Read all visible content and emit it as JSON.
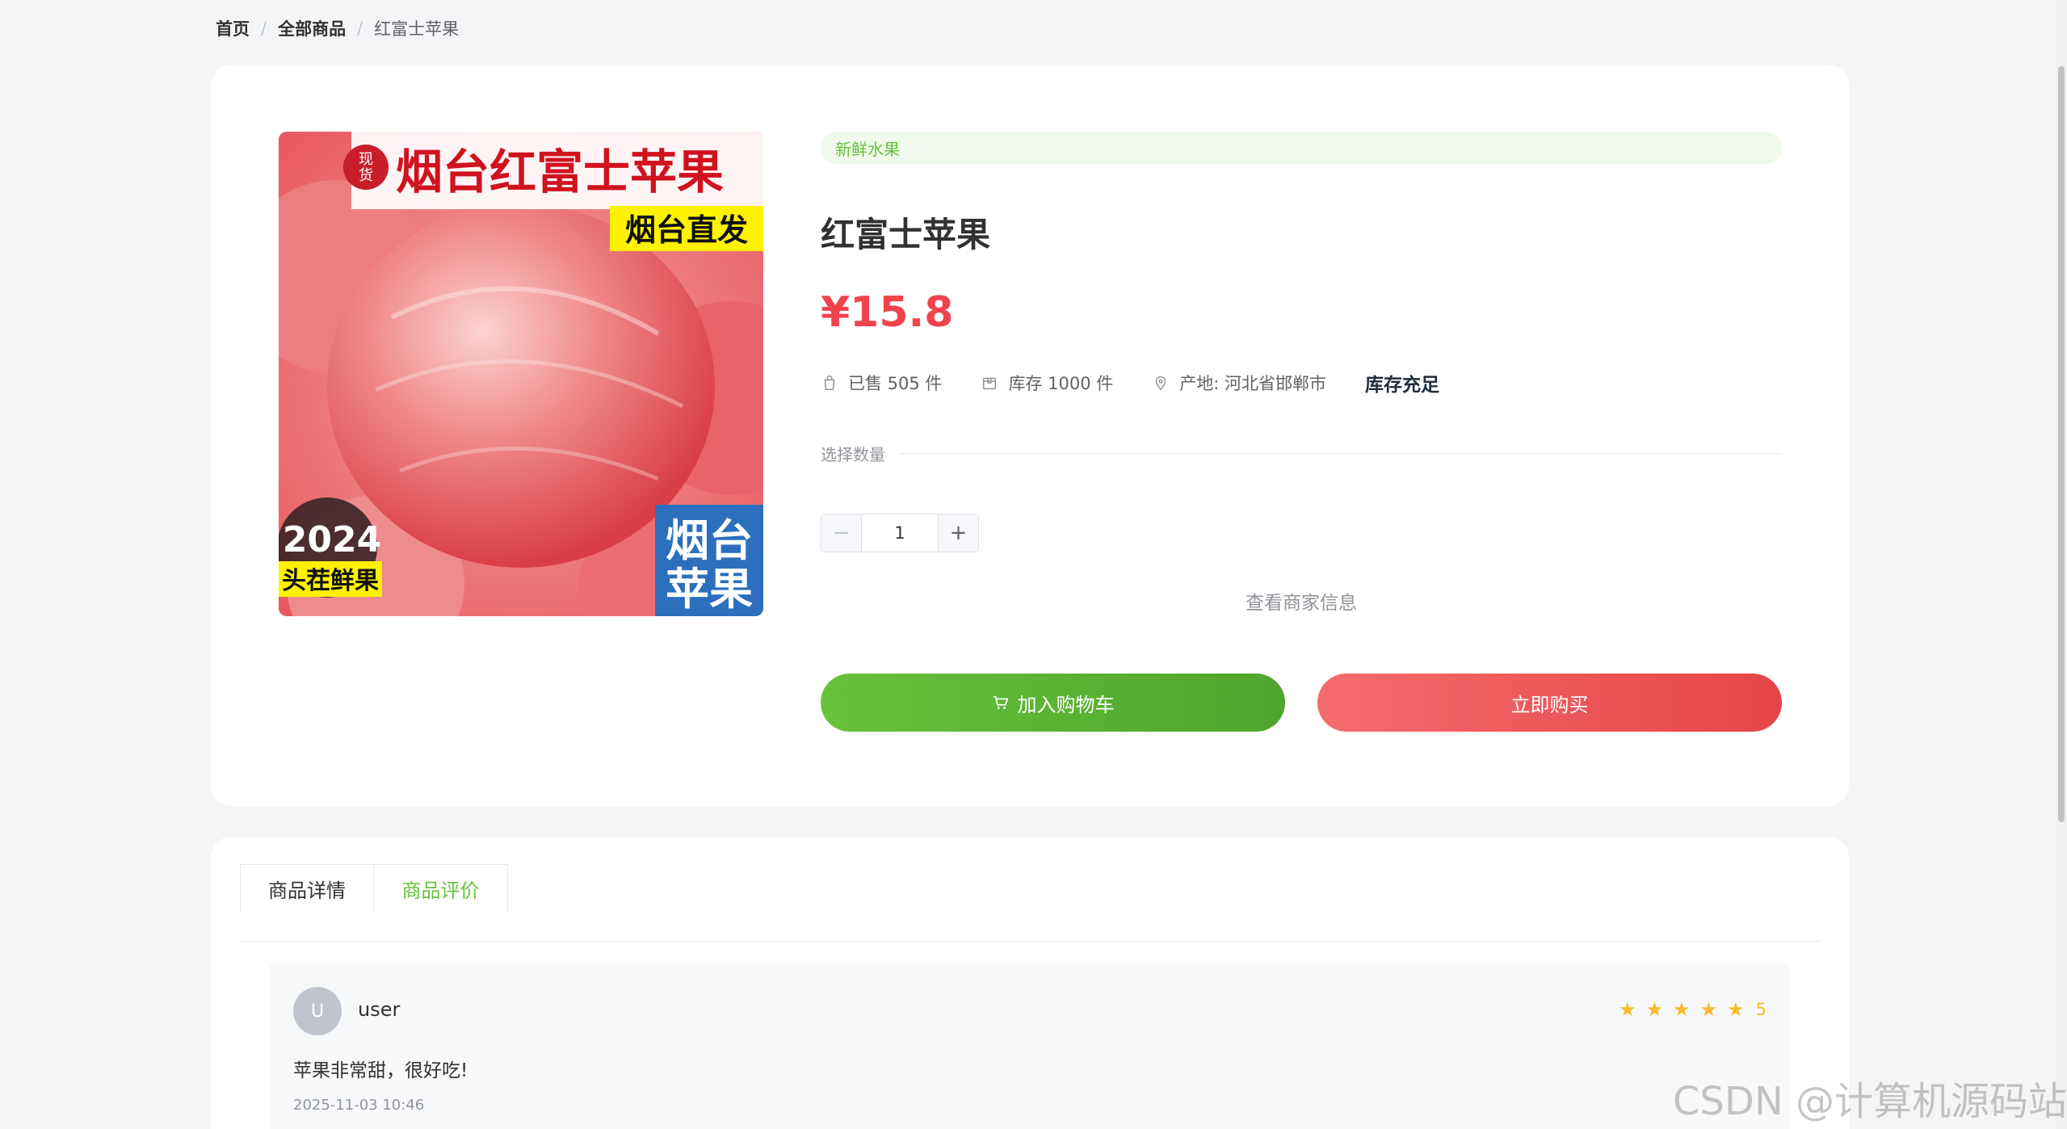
{
  "breadcrumb": {
    "home": "首页",
    "all": "全部商品",
    "current": "红富士苹果"
  },
  "product": {
    "image_text": {
      "badge": "现货",
      "headline": "烟台红富士苹果",
      "tag": "烟台直发",
      "year": "2024",
      "year_sub": "头茬鲜果",
      "corner": "烟台苹果"
    },
    "category": "新鲜水果",
    "title": "红富士苹果",
    "price": "¥15.8",
    "sold": "已售 505 件",
    "stock": "库存 1000 件",
    "origin": "产地: 河北省邯郸市",
    "stock_status": "库存充足",
    "quantity_label": "选择数量",
    "quantity": "1",
    "merchant_link": "查看商家信息",
    "add_to_cart": "加入购物车",
    "buy_now": "立即购买"
  },
  "tabs": [
    {
      "label": "商品详情"
    },
    {
      "label": "商品评价"
    }
  ],
  "review": {
    "avatar": "U",
    "user": "user",
    "rating": "5",
    "text": "苹果非常甜，很好吃!",
    "time": "2025-11-03 10:46"
  },
  "watermark": "CSDN @计算机源码站",
  "colors": {
    "accent_green": "#67c23a",
    "price_red": "#f0434d",
    "buy_red": "#e54449"
  },
  "icons": [
    "bag-icon",
    "box-icon",
    "location-pin-icon",
    "cart-icon",
    "star-icon"
  ]
}
